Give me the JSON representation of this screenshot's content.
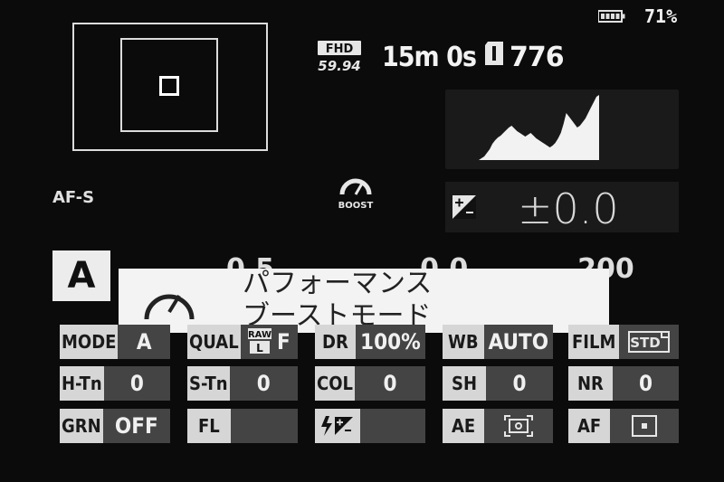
{
  "status": {
    "battery_percent": "71%"
  },
  "movie": {
    "format_top": "FHD",
    "format_bottom": "59.94",
    "record_time": "15m 0s",
    "shots_remaining": "776"
  },
  "focus": {
    "mode": "AF-S"
  },
  "exposure": {
    "mode": "A",
    "compensation": "±0.0",
    "behind_popup_values": [
      "0.5",
      "0.0",
      "200"
    ]
  },
  "popup": {
    "title": "パフォーマンス\nブーストモード"
  },
  "grid": {
    "row1": [
      {
        "label": "MODE",
        "value": "A"
      },
      {
        "label": "QUAL",
        "value": "F"
      },
      {
        "label": "DR",
        "value": "100%"
      },
      {
        "label": "WB",
        "value": "AUTO"
      },
      {
        "label": "FILM",
        "value": "STD"
      }
    ],
    "row2": [
      {
        "label": "H-Tn",
        "value": "0"
      },
      {
        "label": "S-Tn",
        "value": "0"
      },
      {
        "label": "COL",
        "value": "0"
      },
      {
        "label": "SH",
        "value": "0"
      },
      {
        "label": "NR",
        "value": "0"
      }
    ],
    "row3": [
      {
        "label": "GRN",
        "value": "OFF"
      },
      {
        "label": "FL",
        "value": ""
      },
      {
        "label": "",
        "value": ""
      },
      {
        "label": "AE",
        "value": ""
      },
      {
        "label": "AF",
        "value": ""
      }
    ]
  },
  "icons": {
    "battery": "battery-icon",
    "card": "sd-card-icon",
    "boost": "boost-icon",
    "exposure_comp": "exposure-compensation-icon",
    "flash_comp": "flash-compensation-icon",
    "metering": "metering-multi-icon",
    "af_mode": "af-single-point-icon",
    "raw": "raw-icon"
  },
  "histogram": [
    0,
    0,
    2,
    4,
    8,
    12,
    18,
    22,
    25,
    27,
    30,
    33,
    36,
    38,
    35,
    32,
    30,
    28,
    26,
    28,
    30,
    27,
    24,
    22,
    20,
    18,
    16,
    14,
    16,
    19,
    24,
    30,
    40,
    52,
    48,
    44,
    40,
    36,
    38,
    42,
    46,
    52,
    58,
    64,
    70,
    72
  ]
}
